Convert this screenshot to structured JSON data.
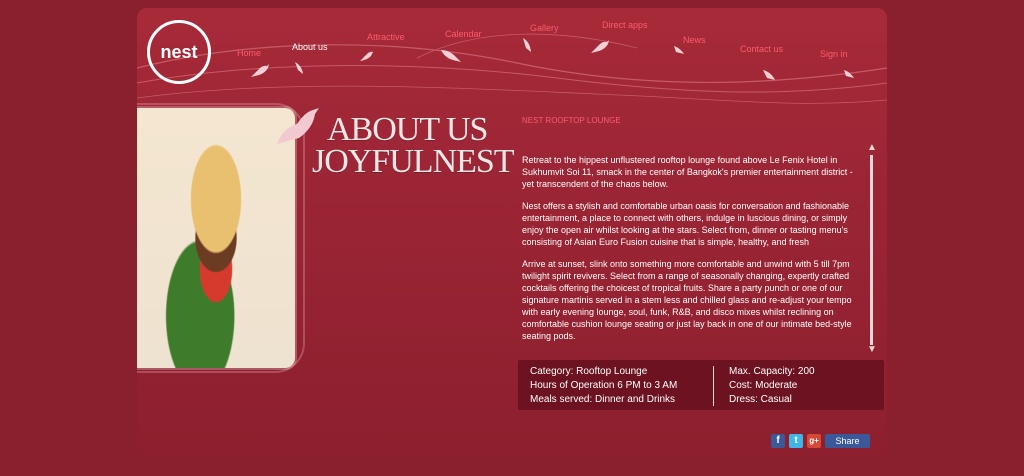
{
  "brand": {
    "logo_text": "nest"
  },
  "nav": {
    "items": [
      {
        "label": "Home"
      },
      {
        "label": "About us"
      },
      {
        "label": "Attractive"
      },
      {
        "label": "Calendar"
      },
      {
        "label": "Gallery"
      },
      {
        "label": "Direct apps"
      },
      {
        "label": "News"
      },
      {
        "label": "Contact us"
      },
      {
        "label": "Sign in"
      }
    ],
    "active": "About us"
  },
  "page": {
    "title_line1": "ABOUT US",
    "title_line2": "JOYFULNEST",
    "section_heading": "NEST ROOFTOP LOUNGE"
  },
  "content": {
    "p1": "Retreat to the hippest unflustered rooftop lounge found above Le Fenix Hotel in Sukhumvit Soi 11, smack in the center of Bangkok's premier entertainment district - yet transcendent of the chaos below.",
    "p2": "Nest offers a stylish and comfortable urban oasis for conversation and fashionable entertainment, a place to connect with others, indulge in luscious dining, or simply enjoy the open air whilst looking at the stars. Select from, dinner or tasting menu's consisting of Asian Euro Fusion cuisine that is simple, healthy, and fresh",
    "p3": "Arrive at sunset, slink onto something more comfortable and unwind with 5 till 7pm twilight spirit revivers. Select from a range of seasonally changing, expertly crafted cocktails offering the choicest of tropical fruits. Share a party punch or one of our signature martinis served in a stem less and chilled glass and re-adjust your tempo with early evening lounge, soul, funk, R&B, and disco mixes whilst reclining on comfortable cushion lounge seating  or just lay back  in one of our intimate bed-style seating pods."
  },
  "info": {
    "category": "Category: Rooftop Lounge",
    "hours": "Hours of Operation 6 PM to 3 AM",
    "meals": "Meals served: Dinner and Drinks",
    "capacity": "Max. Capacity: 200",
    "cost": "Cost: Moderate",
    "dress": "Dress: Casual"
  },
  "social": {
    "facebook_icon": "facebook-icon",
    "twitter_icon": "twitter-icon",
    "googleplus_icon": "googleplus-icon",
    "share_label": "Share"
  },
  "colors": {
    "background": "#8a1f2e",
    "panel": "#9b2535",
    "nav_text": "#ff5a6e",
    "info_box": "#6d1221"
  }
}
